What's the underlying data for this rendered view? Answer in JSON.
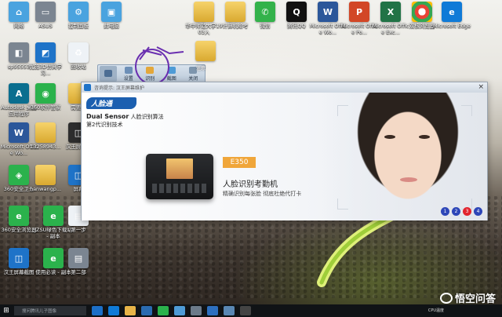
{
  "desktop": {
    "icons": [
      {
        "label": "网络",
        "glyph": "⌂",
        "color": "g-ltblue"
      },
      {
        "label": "ASUS",
        "glyph": "▭",
        "color": "g-grey"
      },
      {
        "label": "控制面板",
        "glyph": "⚙",
        "color": "g-ltblue"
      },
      {
        "label": "此电脑",
        "glyph": "▣",
        "color": "g-ltblue"
      },
      {
        "label": "华中师范大学1903入",
        "glyph": "",
        "color": "g-folder"
      },
      {
        "label": "计算机给考",
        "glyph": "",
        "color": "g-folder"
      },
      {
        "label": "微信",
        "glyph": "✆",
        "color": "g-wechat"
      },
      {
        "label": "腾讯QQ",
        "glyph": "Q",
        "color": "g-qq"
      },
      {
        "label": "Microsoft Office Wo...",
        "glyph": "W",
        "color": "g-word"
      },
      {
        "label": "Microsoft Office Po...",
        "glyph": "P",
        "color": "g-ppt"
      },
      {
        "label": "Microsoft Office Exc...",
        "glyph": "X",
        "color": "g-excel"
      },
      {
        "label": "双核浏览器",
        "glyph": "",
        "color": "g-chrome"
      },
      {
        "label": "Microsoft Edge",
        "glyph": "e",
        "color": "g-edge"
      },
      {
        "label": "sp95553",
        "glyph": "◧",
        "color": "g-grey"
      },
      {
        "label": "优施3D仿真学习...",
        "glyph": "◩",
        "color": "g-blue"
      },
      {
        "label": "回收站",
        "glyph": "♻",
        "color": "g-white"
      },
      {
        "label": "Autodesk 桌面应用程序",
        "glyph": "A",
        "color": "g-autodesk"
      },
      {
        "label": "360软件管家",
        "glyph": "◉",
        "color": "g-360"
      },
      {
        "label": "需要用",
        "glyph": "",
        "color": "g-folder"
      },
      {
        "label": "Microsoft Office Wo...",
        "glyph": "W",
        "color": "g-word"
      },
      {
        "label": "13258943...",
        "glyph": "",
        "color": "g-folder"
      },
      {
        "label": "汉王屏幕扫",
        "glyph": "◫",
        "color": "g-dark"
      },
      {
        "label": "360安全卫士",
        "glyph": "◈",
        "color": "g-360"
      },
      {
        "label": "hanwangp...",
        "glyph": "",
        "color": "g-folder"
      },
      {
        "label": "屏幕",
        "glyph": "◫",
        "color": "g-blue"
      },
      {
        "label": "360安全浏览器",
        "glyph": "e",
        "color": "g-360"
      },
      {
        "label": "JZSU绿色下载站 - 副本",
        "glyph": "e",
        "color": "g-360"
      },
      {
        "label": "第一步",
        "glyph": "▤",
        "color": "g-white"
      },
      {
        "label": "汉王屏幕截图",
        "glyph": "◫",
        "color": "g-blue"
      },
      {
        "label": "使用必读 - 副本",
        "glyph": "e",
        "color": "g-360"
      },
      {
        "label": "第二部",
        "glyph": "▤",
        "color": "g-grey"
      },
      {
        "label": "",
        "glyph": "",
        "color": "g-folder"
      }
    ]
  },
  "toolbar": {
    "buttons": [
      {
        "label": "",
        "name": "toolbar-icon-button"
      },
      {
        "label": "设置",
        "name": "settings-button"
      },
      {
        "label": "识别",
        "name": "recognize-button"
      },
      {
        "label": "截图",
        "name": "screenshot-button"
      },
      {
        "label": "关闭",
        "name": "close-toolbar-button"
      }
    ],
    "hidden_label": "注意"
  },
  "window": {
    "title": "咨询提示: 汉王屏幕维护",
    "logo": "人脸通",
    "ds_bold": "Dual Sensor",
    "ds_text": " 人脸识别算法",
    "gen_text": "第2代识别技术",
    "model_badge": "E350",
    "model_name": "人脸识别考勤机",
    "tagline": "精确识别每张脸  彻底杜绝代打卡",
    "pages": [
      "1",
      "2",
      "3",
      "4"
    ],
    "active_page": "3"
  },
  "taskbar": {
    "search_placeholder": "搜问腾讯儿子图像",
    "watermark": "悟空问答",
    "temp": "CPU温度"
  }
}
